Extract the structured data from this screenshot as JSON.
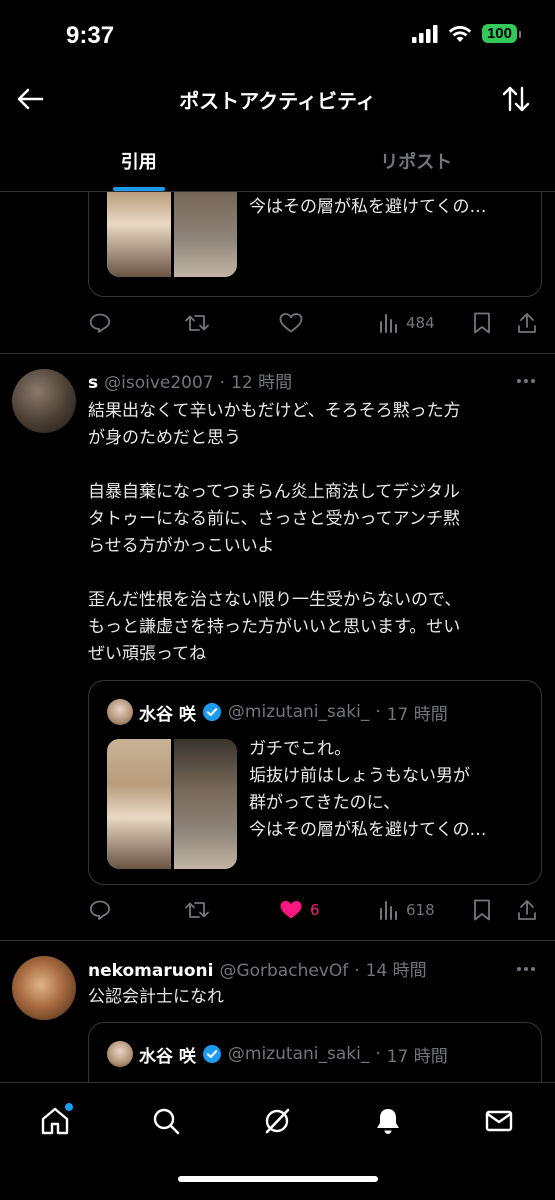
{
  "status_bar": {
    "time": "9:37",
    "battery": "100"
  },
  "header": {
    "title": "ポストアクティビティ"
  },
  "tabs": [
    {
      "label": "引用",
      "active": true
    },
    {
      "label": "リポスト",
      "active": false
    }
  ],
  "posts": [
    {
      "quote": {
        "text_lines": "垢抜け前はしょうもない男が\n群がってきたのに、\n今はその層が私を避けてくの…"
      },
      "actions": {
        "reply": "",
        "repost": "",
        "like": "",
        "views": "484"
      }
    },
    {
      "name": "s",
      "handle": "@isoive2007",
      "time": "12 時間",
      "body": "結果出なくて辛いかもだけど、そろそろ黙った方\nが身のためだと思う\n\n自暴自棄になってつまらん炎上商法してデジタル\nタトゥーになる前に、さっさと受かってアンチ黙\nらせる方がかっこいいよ\n\n歪んだ性根を治さない限り一生受からないので、\nもっと謙虚さを持った方がいいと思います。せい\nぜい頑張ってね",
      "quote": {
        "name": "水谷 咲",
        "handle": "@mizutani_saki_",
        "time": "17 時間",
        "text_lines": "ガチでこれ。\n垢抜け前はしょうもない男が\n群がってきたのに、\n今はその層が私を避けてくの…"
      },
      "actions": {
        "reply": "",
        "repost": "",
        "like": "6",
        "views": "618"
      }
    },
    {
      "name": "nekomaruoni",
      "handle": "@GorbachevOf",
      "time": "14 時間",
      "body": "公認会計士になれ",
      "quote": {
        "name": "水谷 咲",
        "handle": "@mizutani_saki_",
        "time": "17 時間"
      }
    }
  ],
  "colors": {
    "accent": "#1d9bf0",
    "like": "#f91880",
    "muted": "#71767b",
    "battery": "#34c759"
  }
}
